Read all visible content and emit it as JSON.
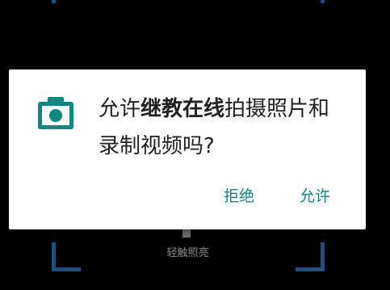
{
  "scanner": {
    "flash_hint": "轻触照亮"
  },
  "dialog": {
    "message_prefix": "允许",
    "app_name": "继教在线",
    "message_suffix": "拍摄照片和录制视频吗?",
    "deny_label": "拒绝",
    "allow_label": "允许",
    "icon": "camera-icon"
  },
  "colors": {
    "accent": "#0b8a7d",
    "frame": "#1e4e80",
    "background": "#000000"
  }
}
